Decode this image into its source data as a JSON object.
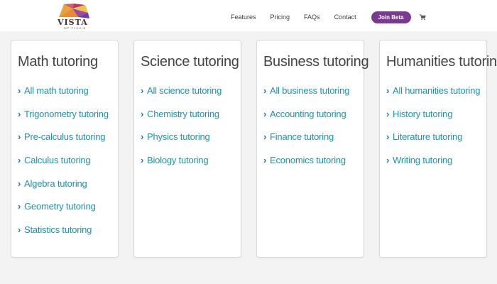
{
  "brand": {
    "logo_word": "VISTA",
    "logo_sub": "WP PLUGIN"
  },
  "nav": {
    "items": [
      "Features",
      "Pricing",
      "FAQs",
      "Contact"
    ],
    "cta_label": "Join Beta",
    "cart_icon": "cart-icon"
  },
  "colors": {
    "accent": "#7a3a8e",
    "link": "#2190a8",
    "heading": "#444444",
    "background": "#f3f3f3"
  },
  "cards": [
    {
      "title": "Math tutoring",
      "links": [
        "All math tutoring",
        "Trigonometry tutoring",
        "Pre-calculus tutoring",
        "Calculus tutoring",
        "Algebra tutoring",
        "Geometry tutoring",
        "Statistics tutoring"
      ]
    },
    {
      "title": "Science tutoring",
      "links": [
        "All science tutoring",
        "Chemistry tutoring",
        "Physics tutoring",
        "Biology tutoring"
      ]
    },
    {
      "title": "Business tutoring",
      "links": [
        "All business tutoring",
        "Accounting tutoring",
        "Finance tutoring",
        "Economics tutoring"
      ]
    },
    {
      "title": "Humanities tutoring",
      "links": [
        "All humanities tutoring",
        "History tutoring",
        "Literature tutoring",
        "Writing tutoring"
      ]
    }
  ]
}
